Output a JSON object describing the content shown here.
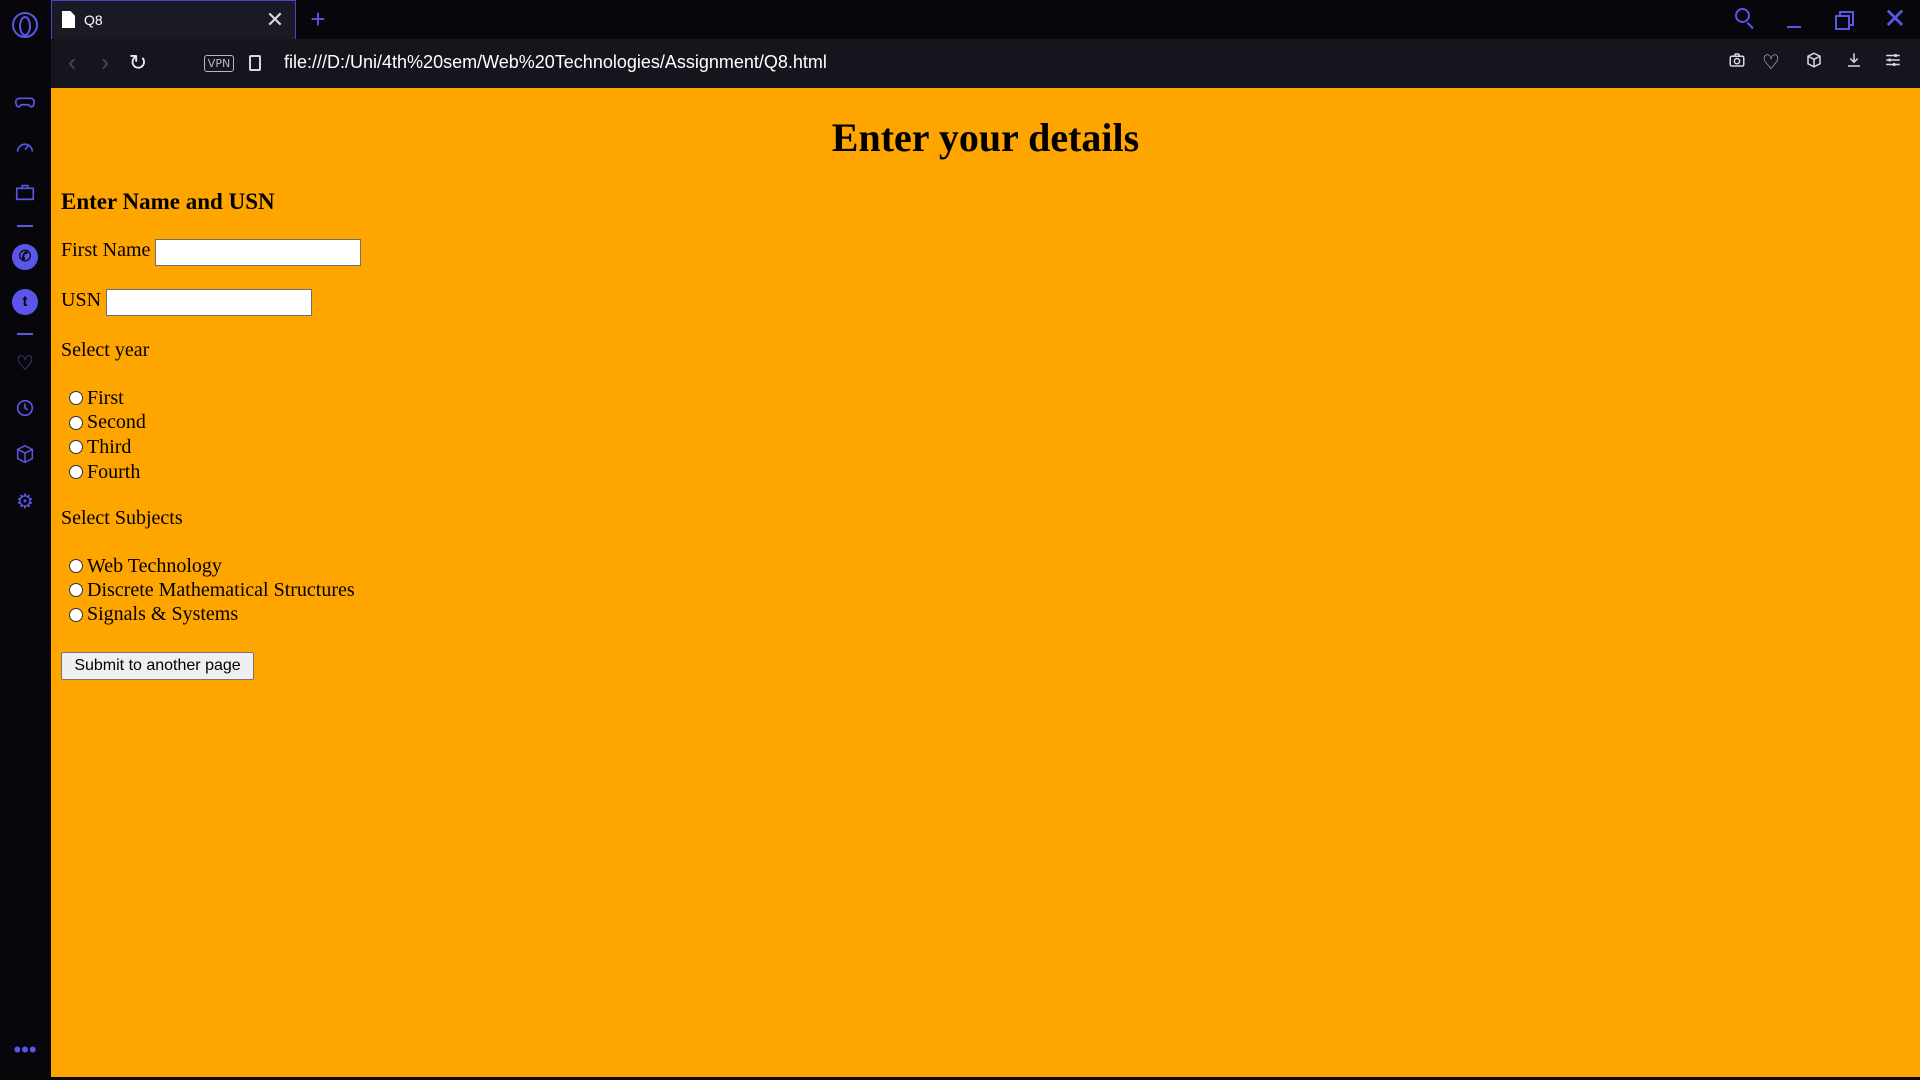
{
  "browser": {
    "tab_title": "Q8",
    "tab_close_icon": "close-icon",
    "new_tab_symbol": "+",
    "close_symbol": "✕",
    "url": "file:///D:/Uni/4th%20sem/Web%20Technologies/Assignment/Q8.html",
    "vpn_label": "VPN",
    "back_symbol": "‹",
    "forward_symbol": "›",
    "reload_symbol": "↻",
    "toolbar_icons": [
      "camera-icon",
      "heart-icon",
      "cube-icon",
      "download-icon",
      "settings-sliders-icon"
    ],
    "sidebar_icons": [
      "gamepad-icon",
      "speed-dial-icon",
      "briefcase-icon",
      "whatsapp-icon",
      "twitter-icon",
      "heart-icon",
      "history-icon",
      "cube-icon",
      "gear-icon",
      "more-icon"
    ],
    "accent_color": "#5b56e8"
  },
  "page": {
    "background_color": "#ffa500",
    "heading": "Enter your details",
    "section_heading": "Enter Name and USN",
    "first_name_label": "First Name",
    "first_name_value": "",
    "usn_label": "USN",
    "usn_value": "",
    "year_prompt": "Select year",
    "years": [
      "First",
      "Second",
      "Third",
      "Fourth"
    ],
    "subjects_prompt": "Select Subjects",
    "subjects": [
      "Web Technology",
      "Discrete Mathematical Structures",
      "Signals & Systems"
    ],
    "submit_label": "Submit to another page"
  }
}
